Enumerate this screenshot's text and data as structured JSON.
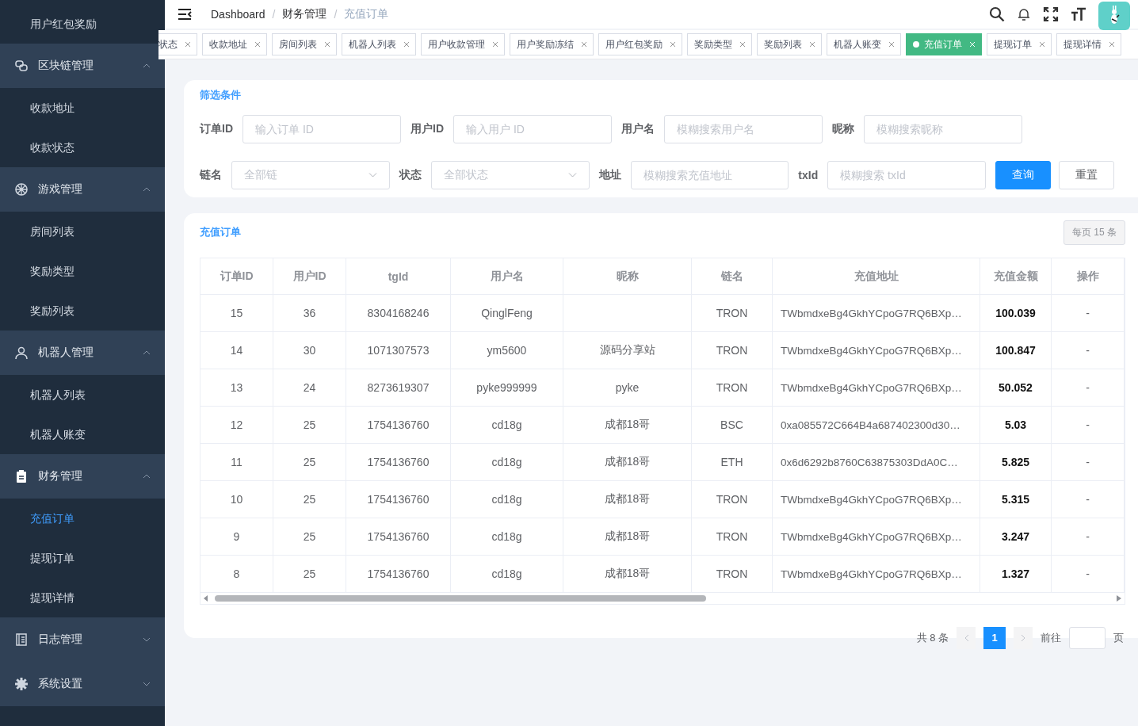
{
  "sidebar": {
    "items": [
      {
        "kind": "item",
        "label": "用户红包奖励",
        "selected": false
      },
      {
        "kind": "group",
        "label": "区块链管理",
        "expanded": true,
        "children": [
          {
            "label": "收款地址",
            "selected": false
          },
          {
            "label": "收款状态",
            "selected": false
          }
        ]
      },
      {
        "kind": "group",
        "label": "游戏管理",
        "expanded": true,
        "children": [
          {
            "label": "房间列表",
            "selected": false
          },
          {
            "label": "奖励类型",
            "selected": false
          },
          {
            "label": "奖励列表",
            "selected": false
          }
        ]
      },
      {
        "kind": "group",
        "label": "机器人管理",
        "expanded": true,
        "children": [
          {
            "label": "机器人列表",
            "selected": false
          },
          {
            "label": "机器人账变",
            "selected": false
          }
        ]
      },
      {
        "kind": "group",
        "label": "财务管理",
        "expanded": true,
        "children": [
          {
            "label": "充值订单",
            "selected": true
          },
          {
            "label": "提现订单",
            "selected": false
          },
          {
            "label": "提现详情",
            "selected": false
          }
        ]
      },
      {
        "kind": "group",
        "label": "日志管理",
        "expanded": false
      },
      {
        "kind": "group",
        "label": "系统设置",
        "expanded": false
      }
    ]
  },
  "breadcrumb": {
    "separator": "/",
    "items": [
      "Dashboard",
      "财务管理",
      "充值订单"
    ]
  },
  "tags": [
    {
      "label": "状态",
      "selected": false
    },
    {
      "label": "收款地址",
      "selected": false
    },
    {
      "label": "房间列表",
      "selected": false
    },
    {
      "label": "机器人列表",
      "selected": false
    },
    {
      "label": "用户收款管理",
      "selected": false
    },
    {
      "label": "用户奖励冻结",
      "selected": false
    },
    {
      "label": "用户红包奖励",
      "selected": false
    },
    {
      "label": "奖励类型",
      "selected": false
    },
    {
      "label": "奖励列表",
      "selected": false
    },
    {
      "label": "机器人账变",
      "selected": false
    },
    {
      "label": "充值订单",
      "selected": true
    },
    {
      "label": "提现订单",
      "selected": false
    },
    {
      "label": "提现详情",
      "selected": false
    }
  ],
  "filter": {
    "title": "筛选条件",
    "rows": [
      [
        {
          "kind": "input",
          "label": "订单ID",
          "placeholder": "输入订单 ID"
        },
        {
          "kind": "input",
          "label": "用户ID",
          "placeholder": "输入用户 ID"
        },
        {
          "kind": "input",
          "label": "用户名",
          "placeholder": "模糊搜索用户名"
        },
        {
          "kind": "input",
          "label": "昵称",
          "placeholder": "模糊搜索昵称"
        }
      ],
      [
        {
          "kind": "select",
          "label": "链名",
          "placeholder": "全部链"
        },
        {
          "kind": "select",
          "label": "状态",
          "placeholder": "全部状态"
        },
        {
          "kind": "input",
          "label": "地址",
          "placeholder": "模糊搜索充值地址"
        },
        {
          "kind": "input",
          "label": "txId",
          "placeholder": "模糊搜索 txId"
        }
      ]
    ],
    "buttons": [
      {
        "label": "查询",
        "kind": "primary"
      },
      {
        "label": "重置",
        "kind": "default"
      }
    ]
  },
  "table": {
    "title": "充值订单",
    "page_size": "每页 15 条",
    "columns": [
      "订单ID",
      "用户ID",
      "tgId",
      "用户名",
      "昵称",
      "链名",
      "充值地址",
      "充值金额",
      "操作"
    ],
    "rows": [
      [
        "15",
        "36",
        "8304168246",
        "QinglFeng",
        "",
        "TRON",
        "TWbmdxeBg4GkhYCpoG7RQ6BXp…",
        "100.039",
        "-"
      ],
      [
        "14",
        "30",
        "1071307573",
        "ym5600",
        "源码分享站",
        "TRON",
        "TWbmdxeBg4GkhYCpoG7RQ6BXp…",
        "100.847",
        "-"
      ],
      [
        "13",
        "24",
        "8273619307",
        "pyke999999",
        "pyke",
        "TRON",
        "TWbmdxeBg4GkhYCpoG7RQ6BXp…",
        "50.052",
        "-"
      ],
      [
        "12",
        "25",
        "1754136760",
        "cd18g",
        "成都18哥",
        "BSC",
        "0xa085572C664B4a687402300d30…",
        "5.03",
        "-"
      ],
      [
        "11",
        "25",
        "1754136760",
        "cd18g",
        "成都18哥",
        "ETH",
        "0x6d6292b8760C63875303DdA0C…",
        "5.825",
        "-"
      ],
      [
        "10",
        "25",
        "1754136760",
        "cd18g",
        "成都18哥",
        "TRON",
        "TWbmdxeBg4GkhYCpoG7RQ6BXp…",
        "5.315",
        "-"
      ],
      [
        "9",
        "25",
        "1754136760",
        "cd18g",
        "成都18哥",
        "TRON",
        "TWbmdxeBg4GkhYCpoG7RQ6BXp…",
        "3.247",
        "-"
      ],
      [
        "8",
        "25",
        "1754136760",
        "cd18g",
        "成都18哥",
        "TRON",
        "TWbmdxeBg4GkhYCpoG7RQ6BXp…",
        "1.327",
        "-"
      ]
    ]
  },
  "pagination": {
    "total": "共 8 条",
    "pages": [
      {
        "label": "1",
        "selected": true
      }
    ],
    "goto": "前往",
    "unit": "页"
  }
}
